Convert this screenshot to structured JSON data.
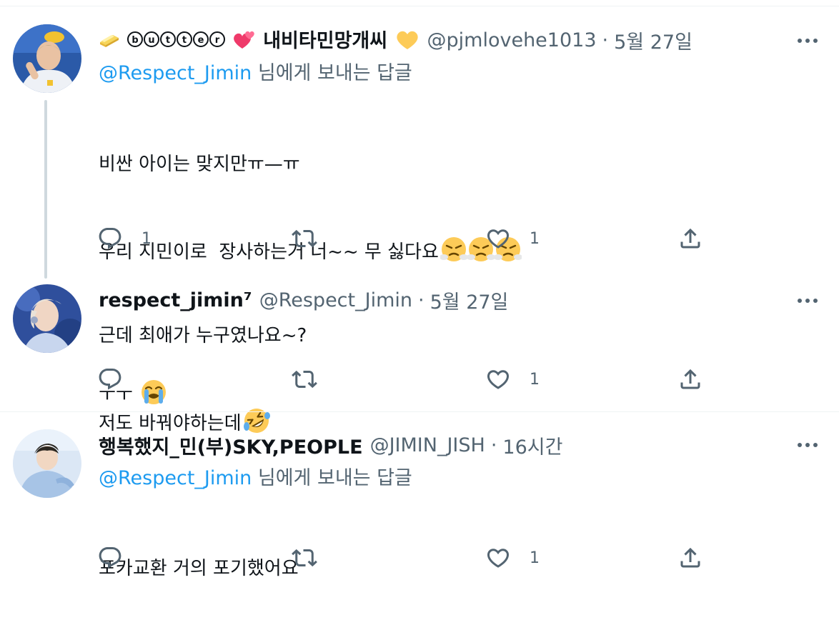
{
  "tweets": [
    {
      "display_name": "🧈ⓑⓤⓣⓣⓔⓡ💕내비타민망개씨💛",
      "display_name_text": "내비타민망개씨",
      "handle": "@pjmlovehe1013",
      "separator": "·",
      "time": "5월 27일",
      "reply_to_mention": "@Respect_Jimin",
      "reply_to_suffix": " 님에게 보내는 답글",
      "body_lines": [
        "비싼 아이는 맞지만ㅠ—ㅠ",
        "우리 지민이로  장사하는거 너~~ 무 싫다요",
        "근데 최애가 누구였나요~?",
        "저도 바꿔야하는데"
      ],
      "reply_count": "1",
      "retweet_count": "",
      "like_count": "1",
      "icons": {
        "reply": "reply-icon",
        "retweet": "retweet-icon",
        "like": "heart-icon",
        "share": "share-icon",
        "more": "more-icon"
      }
    },
    {
      "display_name": "respect_jimin⁷",
      "handle": "@Respect_Jimin",
      "separator": "·",
      "time": "5월 27일",
      "body_lines": [
        "ㅜㅜ "
      ],
      "reply_count": "",
      "retweet_count": "",
      "like_count": "1"
    },
    {
      "display_name": "행복했지_민(부)SKY,PEOPLE",
      "handle": "@JIMIN_JISH",
      "separator": "·",
      "time": "16시간",
      "reply_to_mention": "@Respect_Jimin",
      "reply_to_suffix": " 님에게 보내는 답글",
      "body_lines": [
        "포카교환 거의 포기했어요"
      ],
      "reply_count": "",
      "retweet_count": "",
      "like_count": "1"
    }
  ],
  "colors": {
    "text": "#0f1419",
    "secondary": "#536471",
    "link": "#1d9bf0",
    "divider": "#eff3f4",
    "thread_line": "#cfd9de"
  }
}
